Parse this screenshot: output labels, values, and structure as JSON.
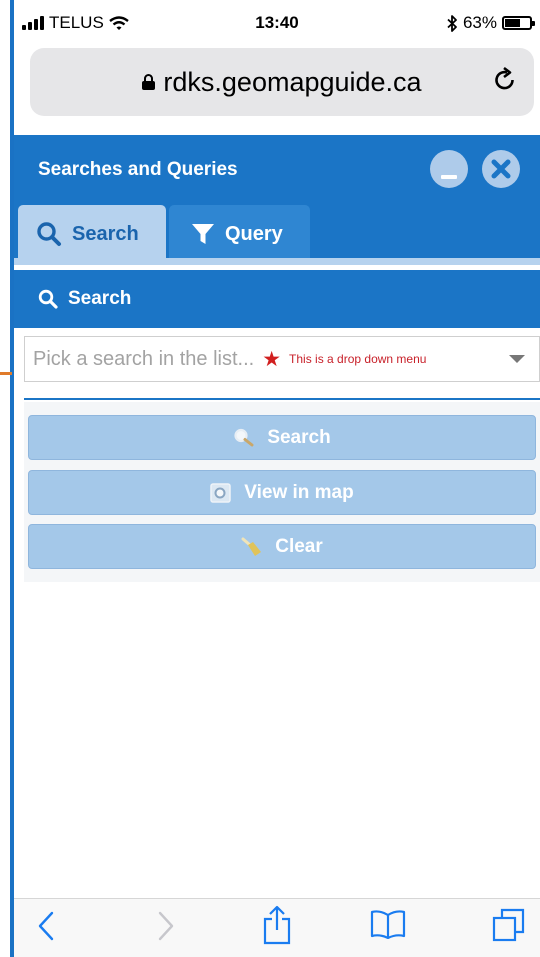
{
  "status_bar": {
    "carrier": "TELUS",
    "time": "13:40",
    "battery_percent": "63%",
    "battery_level": 0.63
  },
  "url_bar": {
    "domain": "rdks.geomapguide.ca"
  },
  "panel": {
    "title": "Searches and Queries"
  },
  "tabs": [
    {
      "label": "Search",
      "icon": "search-icon",
      "active": true
    },
    {
      "label": "Query",
      "icon": "funnel-icon",
      "active": false
    }
  ],
  "section": {
    "title": "Search"
  },
  "search_select": {
    "placeholder": "Pick a search in the list...",
    "annotation": "This is a drop down menu"
  },
  "buttons": {
    "search": "Search",
    "view_in_map": "View in map",
    "clear": "Clear"
  },
  "colors": {
    "header_blue": "#1b75c6",
    "tab_active": "#b6d2ee",
    "button_blue": "#a4c8e9",
    "annotation_red": "#c8212a",
    "ios_blue": "#1a7cf0"
  }
}
